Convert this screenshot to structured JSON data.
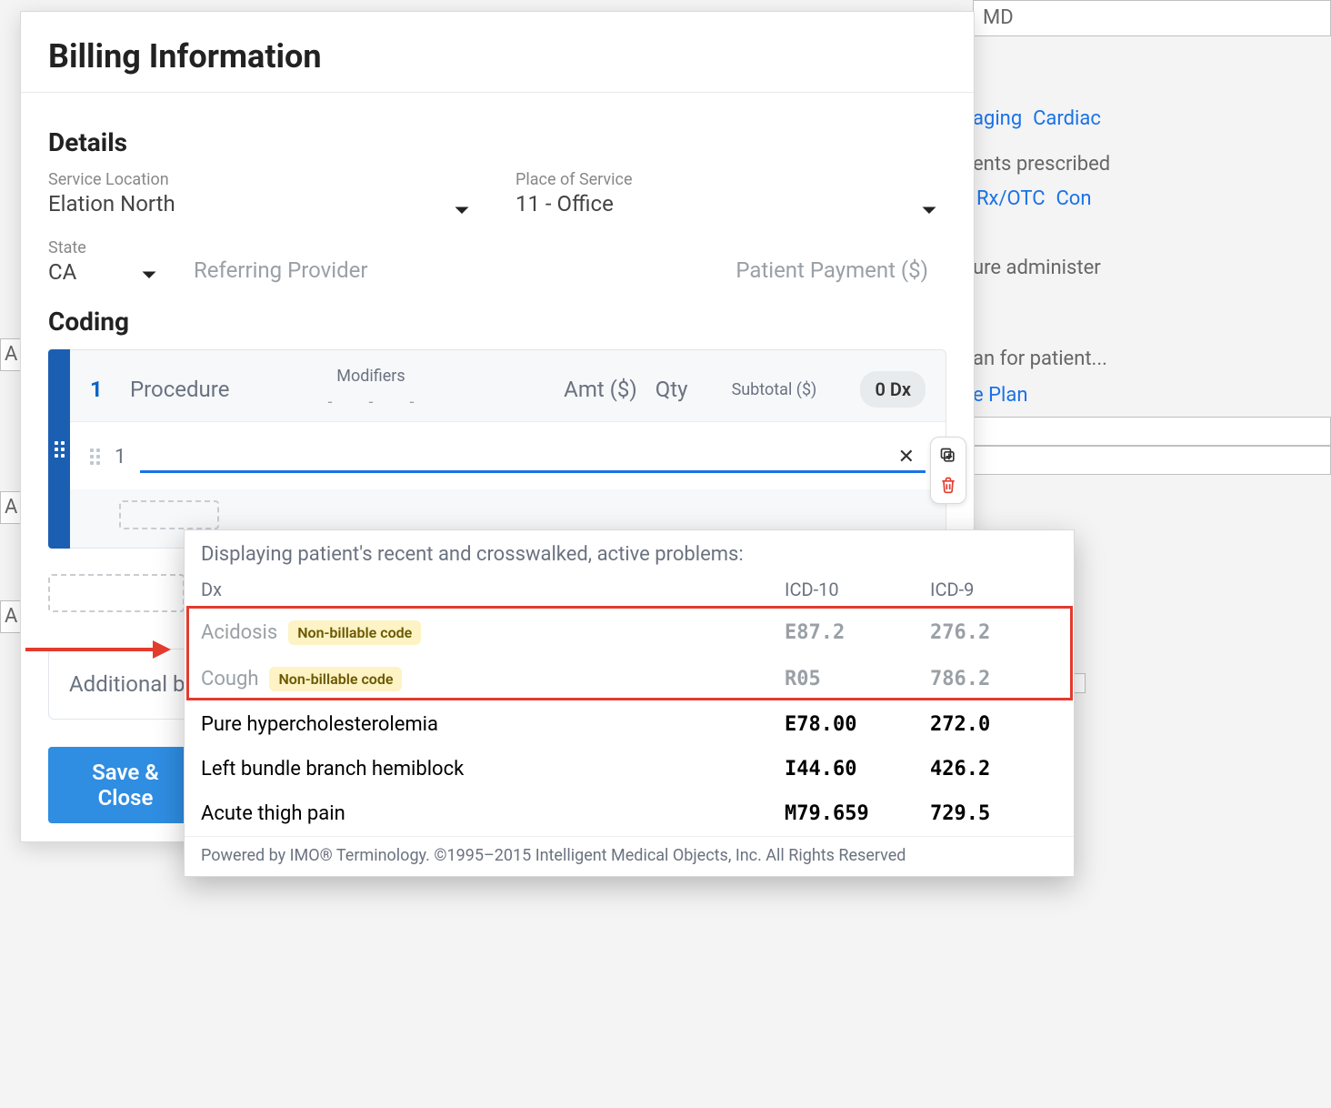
{
  "bg": {
    "text1": "MD",
    "link1": "aging",
    "link2": "Cardiac",
    "text2": "ents prescribed",
    "link3": "Rx/OTC",
    "link4": "Con",
    "text3": "ure administer",
    "text4": "an for patient...",
    "link5": "e Plan",
    "left_a": "A",
    "left_b": "A",
    "left_c": "A"
  },
  "modal": {
    "title": "Billing Information",
    "details": {
      "title": "Details",
      "service_location": {
        "label": "Service Location",
        "value": "Elation North"
      },
      "place_of_service": {
        "label": "Place of Service",
        "value": "11 - Office"
      },
      "state": {
        "label": "State",
        "value": "CA"
      },
      "referring_provider_placeholder": "Referring Provider",
      "patient_payment_placeholder": "Patient Payment ($)"
    },
    "coding": {
      "title": "Coding",
      "row_number": "1",
      "procedure_label": "Procedure",
      "modifiers_label": "Modifiers",
      "mod_slot": "-",
      "amount_label": "Amt ($)",
      "qty_label": "Qty",
      "subtotal_label": "Subtotal ($)",
      "dx_pill": "0 Dx",
      "dx_line_number": "1",
      "dx_input_value": ""
    },
    "additional_placeholder": "Additional bi",
    "save_button": "Save & Close"
  },
  "dropdown": {
    "heading": "Displaying patient's recent and crosswalked, active problems:",
    "columns": {
      "dx": "Dx",
      "icd10": "ICD-10",
      "icd9": "ICD-9"
    },
    "nonbillable_badge": "Non-billable code",
    "rows": [
      {
        "name": "Acidosis",
        "icd10": "E87.2",
        "icd9": "276.2",
        "nonbillable": true
      },
      {
        "name": "Cough",
        "icd10": "R05",
        "icd9": "786.2",
        "nonbillable": true
      },
      {
        "name": "Pure hypercholesterolemia",
        "icd10": "E78.00",
        "icd9": "272.0",
        "nonbillable": false
      },
      {
        "name": "Left bundle branch hemiblock",
        "icd10": "I44.60",
        "icd9": "426.2",
        "nonbillable": false
      },
      {
        "name": "Acute thigh pain",
        "icd10": "M79.659",
        "icd9": "729.5",
        "nonbillable": false
      }
    ],
    "footer": "Powered by IMO® Terminology. ©1995–2015 Intelligent Medical Objects, Inc. All Rights Reserved"
  }
}
